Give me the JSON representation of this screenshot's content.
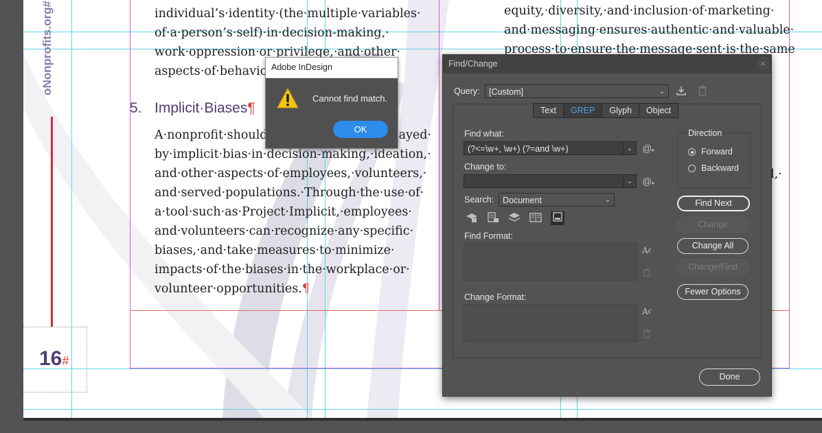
{
  "document": {
    "left_column_top_lines": [
      "individual’s·identity·(the·multiple·variables·",
      "of·a·person’s·self)·in·decision-making,·",
      "work·oppression·or·privilege,·and·other·",
      "aspects·of·behavior"
    ],
    "heading_number": "5.",
    "heading_text": "Implicit·Biases",
    "heading_mark": "¶",
    "body_lines": [
      "A·nonprofit·should",
      "by·implicit·bias·in·decision-making,·ideation,·",
      "and·other·aspects·of·employees,·volunteers,·",
      "and·served·populations.·Through·the·use·of·",
      "a·tool·such·as·Project·Implicit,·employees·",
      "and·volunteers·can·recognize·any·specific·",
      "biases,·and·take·measures·to·minimize·",
      "impacts·of·the·biases·in·the·workplace·or·",
      "volunteer·opportunities."
    ],
    "body_line_1_tail": "layed·",
    "body_end_mark": "¶",
    "right_column_lines": [
      "equity,·diversity,·and·inclusion·of·marketing·",
      "and·messaging·ensures·authentic·and·valuable·",
      "process·to·ensure·the·message·sent·is·the·same"
    ],
    "right_column_fragment": "l,·",
    "vertical_url": "oNonprofits.org#",
    "folio_number": "16",
    "folio_mark": "#"
  },
  "alert": {
    "title": "Adobe InDesign",
    "message": "Cannot find match.",
    "ok_label": "OK",
    "icon": "warning-icon"
  },
  "find_change": {
    "title": "Find/Change",
    "close_label": "×",
    "query_label": "Query:",
    "query_value": "[Custom]",
    "tabs": [
      {
        "label": "Text",
        "active": false
      },
      {
        "label": "GREP",
        "active": true
      },
      {
        "label": "Glyph",
        "active": false
      },
      {
        "label": "Object",
        "active": false
      }
    ],
    "find_what_label": "Find what:",
    "find_what_value": "(?<=\\w+, \\w+) (?=and \\w+)",
    "change_to_label": "Change to:",
    "change_to_value": "",
    "search_label": "Search:",
    "search_value": "Document",
    "find_format_label": "Find Format:",
    "change_format_label": "Change Format:",
    "direction_label": "Direction",
    "forward_label": "Forward",
    "backward_label": "Backward",
    "direction_selected": "Forward",
    "buttons": {
      "find_next": "Find Next",
      "change": "Change",
      "change_all": "Change All",
      "change_find": "Change/Find",
      "fewer_options": "Fewer Options",
      "done": "Done"
    },
    "accent_color": "#4f9ff0"
  }
}
